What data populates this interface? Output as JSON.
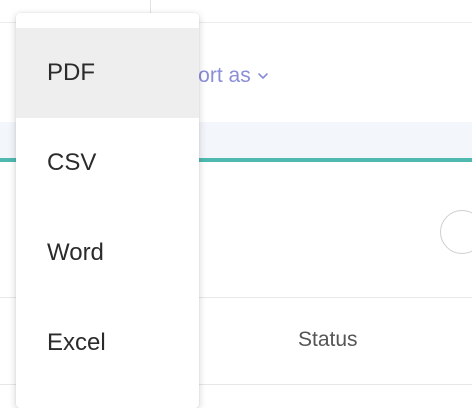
{
  "toolbar": {
    "export_label": "xport as",
    "export_icon": "chevron-down-icon"
  },
  "table": {
    "columns": [
      "Status"
    ]
  },
  "export_menu": {
    "items": [
      {
        "label": "PDF",
        "highlighted": true
      },
      {
        "label": "CSV",
        "highlighted": false
      },
      {
        "label": "Word",
        "highlighted": false
      },
      {
        "label": "Excel",
        "highlighted": false
      }
    ]
  },
  "colors": {
    "accent": "#4fb9b0",
    "link": "#8a8ed6",
    "menu_highlight": "#eeeeee"
  }
}
